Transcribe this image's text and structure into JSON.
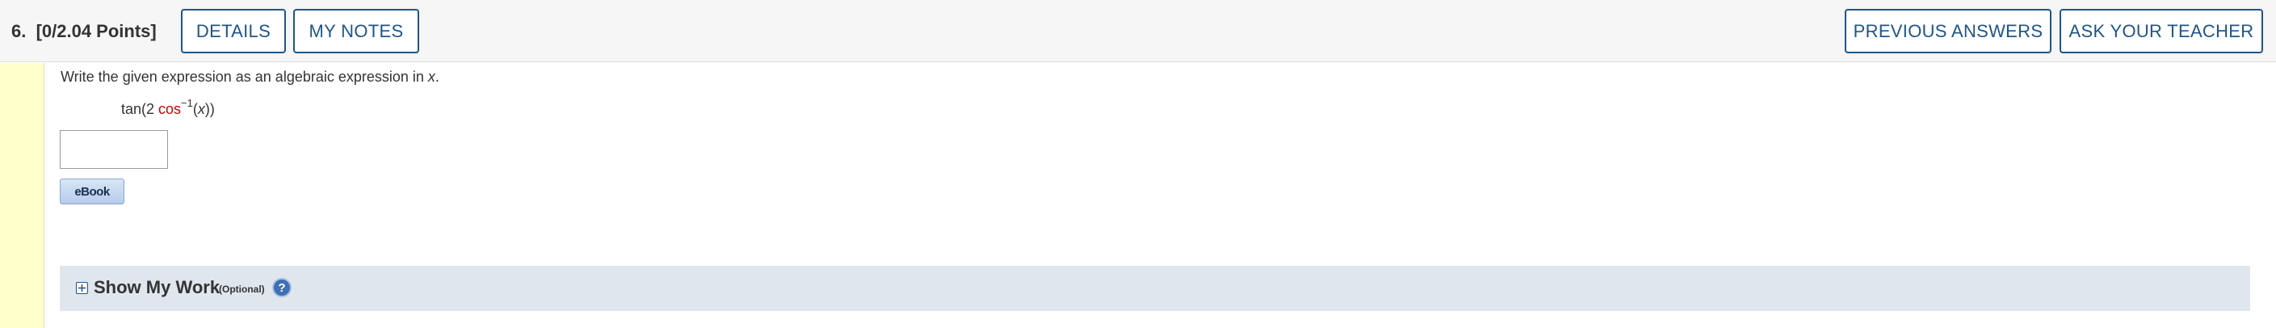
{
  "header": {
    "question_title": "6.  [0/2.04 Points]",
    "details_label": "DETAILS",
    "my_notes_label": "MY NOTES",
    "previous_answers_label": "PREVIOUS ANSWERS",
    "ask_teacher_label": "ASK YOUR TEACHER"
  },
  "question": {
    "prompt_before": "Write the given expression as an algebraic expression in ",
    "prompt_var": "x",
    "prompt_after": ".",
    "expr_prefix": "tan(2 ",
    "expr_func": "cos",
    "expr_exponent": "−1",
    "expr_open": "(",
    "expr_var": "x",
    "expr_close": "))",
    "answer_value": "",
    "ebook_label": "eBook"
  },
  "show_my_work": {
    "title": "Show My Work",
    "optional_label": "(Optional)",
    "help_symbol": "?"
  },
  "colors": {
    "accent": "#1f5588",
    "function_red": "#cc0000",
    "left_strip": "#ffffcc",
    "panel_bg": "#dfe6ee"
  },
  "icons": {
    "expand": "plus-square-icon",
    "help": "question-circle-icon"
  }
}
